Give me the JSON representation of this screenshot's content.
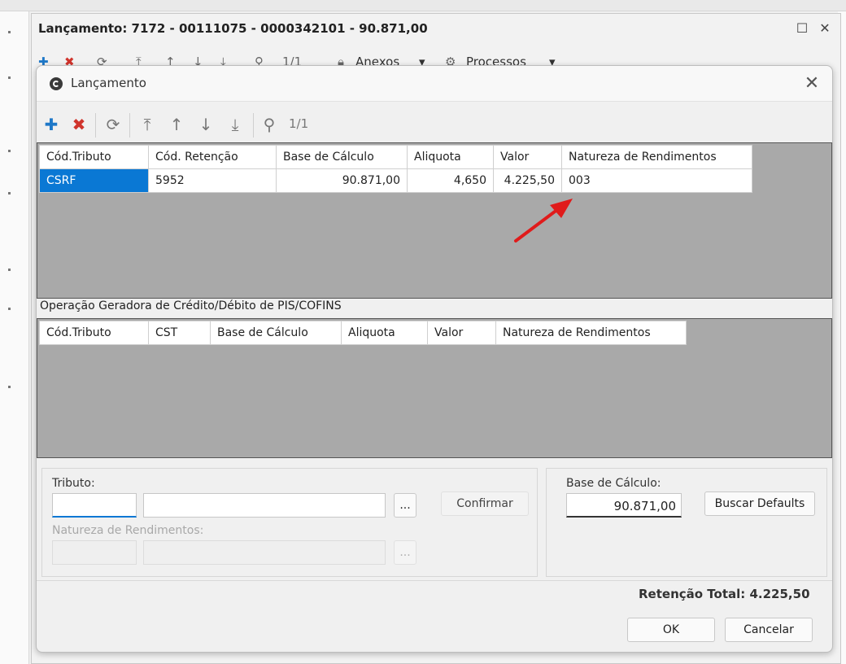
{
  "outer_window": {
    "title": "Lançamento: 7172 - 00111075 - 0000342101 - 90.871,00",
    "toolbar": {
      "count": "1/1",
      "anexos_label": "Anexos",
      "processos_label": "Processos"
    }
  },
  "dialog": {
    "title": "Lançamento",
    "toolbar": {
      "count": "1/1"
    },
    "retencoes": {
      "columns": [
        "Cód.Tributo",
        "Cód. Retenção",
        "Base de Cálculo",
        "Aliquota",
        "Valor",
        "Natureza de Rendimentos"
      ],
      "rows": [
        [
          "CSRF",
          "5952",
          "90.871,00",
          "4,650",
          "4.225,50",
          "003"
        ]
      ]
    },
    "pis_cofins": {
      "label": "Operação Geradora de Crédito/Débito de PIS/COFINS",
      "columns": [
        "Cód.Tributo",
        "CST",
        "Base de Cálculo",
        "Aliquota",
        "Valor",
        "Natureza de Rendimentos"
      ]
    },
    "form": {
      "tributo_label": "Tributo:",
      "tributo_code": "",
      "tributo_desc": "",
      "ellipsis": "...",
      "confirmar_label": "Confirmar",
      "natureza_label": "Natureza de Rendimentos:",
      "base_label": "Base de Cálculo:",
      "base_value": "90.871,00",
      "buscar_label": "Buscar Defaults"
    },
    "retencao_total": "Retenção Total: 4.225,50",
    "ok_label": "OK",
    "cancelar_label": "Cancelar"
  },
  "colors": {
    "selection": "#0a78d4",
    "add_icon": "#1e78c8",
    "delete_icon": "#d0342c",
    "arrow": "#e01b1b"
  }
}
